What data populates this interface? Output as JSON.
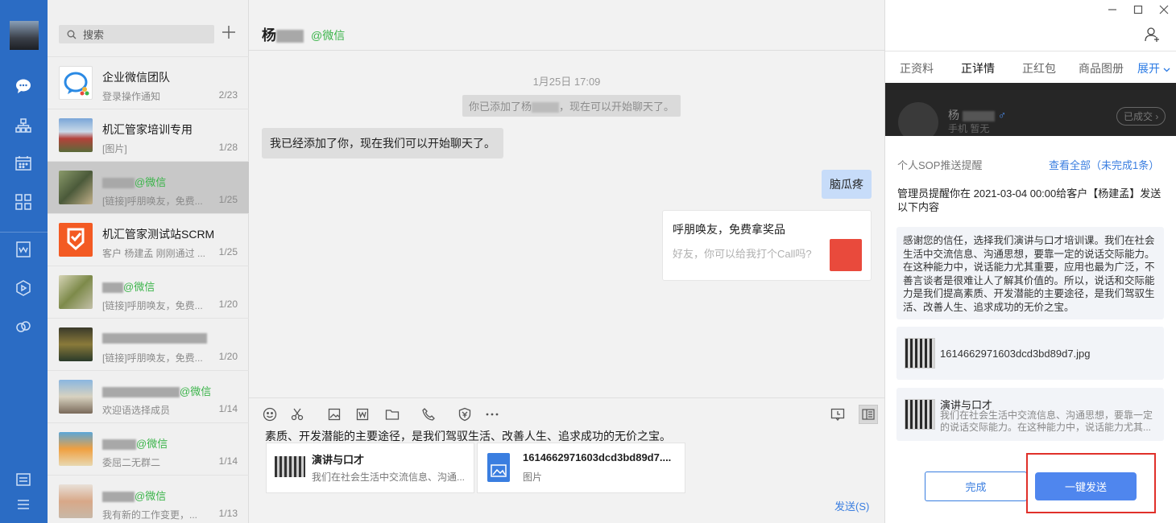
{
  "search": {
    "placeholder": "搜索"
  },
  "conversations": [
    {
      "name": "企业微信团队",
      "wx": "",
      "sub": "登录操作通知",
      "count": "2/23"
    },
    {
      "name": "机汇管家培训专用",
      "wx": "",
      "sub": "[图片]",
      "count": "1/28"
    },
    {
      "name": "",
      "wx": "@微信",
      "sub": "[链接]呼朋唤友，免费...",
      "count": "1/25"
    },
    {
      "name": "机汇管家测试站SCRM",
      "wx": "",
      "sub": "客户 杨建孟 刚刚通过 ...",
      "count": "1/25"
    },
    {
      "name": "",
      "wx": "@微信",
      "sub": "[链接]呼朋唤友，免费...",
      "count": "1/20"
    },
    {
      "name": "",
      "wx": "",
      "sub": "[链接]呼朋唤友，免费...",
      "count": "1/20"
    },
    {
      "name": "",
      "wx": "@微信",
      "sub": "欢迎语选择成员",
      "count": "1/14"
    },
    {
      "name": "",
      "wx": "@微信",
      "sub": "委屈二无群二",
      "count": "1/14"
    },
    {
      "name": "",
      "wx": "@微信",
      "sub": "我有新的工作变更，...",
      "count": "1/13"
    }
  ],
  "chat": {
    "title": "杨",
    "wx": "@微信",
    "time": "1月25日 17:09",
    "system_prefix": "你已添加了杨",
    "system_suffix": "，现在可以开始聊天了。",
    "msg_left": "我已经添加了你，现在我们可以开始聊天了。",
    "msg_right": "脑瓜疼",
    "card_title": "呼朋唤友，免费拿奖品",
    "card_desc": "好友，你可以给我打个Call吗?",
    "draft": "素质、开发潜能的主要途径，是我们驾驭生活、改善人生、追求成功的无价之宝。",
    "attachments": [
      {
        "title": "演讲与口才",
        "desc": "我们在社会生活中交流信息、沟通..."
      },
      {
        "title": "1614662971603dcd3bd89d7....",
        "desc": "图片"
      }
    ],
    "send": "发送(S)"
  },
  "panel": {
    "tabs": [
      "正资料",
      "正详情",
      "正红包",
      "商品图册",
      "展开"
    ],
    "profile_name": "杨",
    "profile_tags": "手机  暂无",
    "profile_btn": "已成交",
    "sop_title": "个人SOP推送提醒",
    "sop_all": "查看全部（未完成1条）",
    "sop_desc": "管理员提醒你在 2021-03-04 00:00给客户【杨建孟】发送以下内容",
    "sop_text": "感谢您的信任，选择我们演讲与口才培训课。我们在社会生活中交流信息、沟通思想，要靠一定的说话交际能力。在这种能力中，说话能力尤其重要，应用也最为广泛，不善言谈者是很难让人了解其价值的。所以，说话和交际能力是我们提高素质、开发潜能的主要途径，是我们驾驭生活、改善人生、追求成功的无价之宝。",
    "file_name": "1614662971603dcd3bd89d7.jpg",
    "link_title": "演讲与口才",
    "link_desc": "我们在社会生活中交流信息、沟通思想，要靠一定的说话交际能力。在这种能力中，说话能力尤其...",
    "btn_done": "完成",
    "btn_send": "一键发送"
  },
  "colors": {
    "nav": "#2b6cc4",
    "accent": "#3a7ee0",
    "wx_green": "#3bb44a",
    "highlight": "#e0302a"
  }
}
